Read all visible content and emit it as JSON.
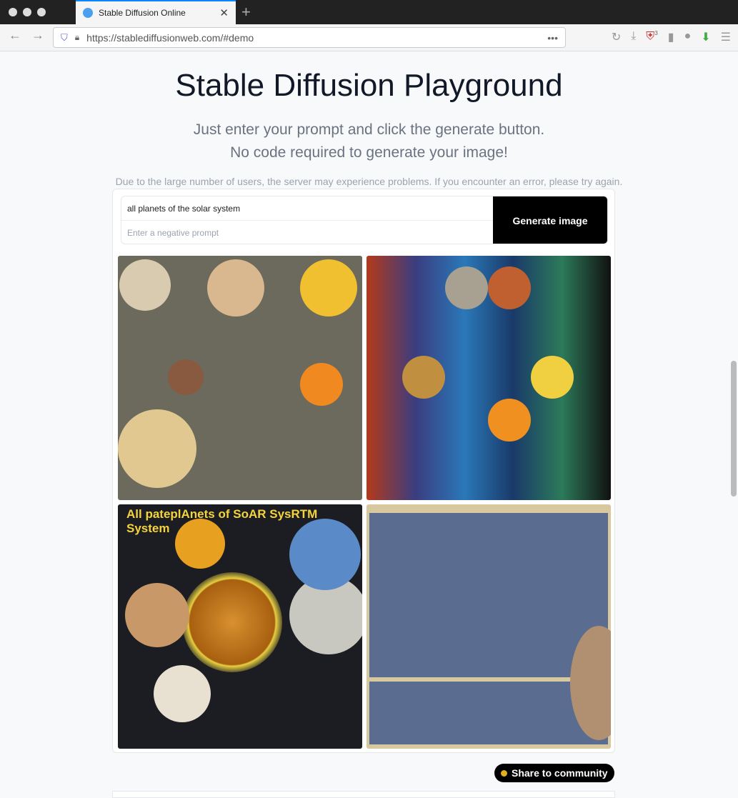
{
  "browser": {
    "tab_title": "Stable Diffusion Online",
    "url": "https://stablediffusionweb.com/#demo",
    "badge": "3"
  },
  "page": {
    "title": "Stable Diffusion Playground",
    "subtitle1": "Just enter your prompt and click the generate button.",
    "subtitle2": "No code required to generate your image!",
    "notice": "Due to the large number of users, the server may experience problems. If you encounter an error, please try again."
  },
  "form": {
    "prompt": "all planets of the solar system",
    "negative_placeholder": "Enter a negative prompt",
    "generate_label": "Generate image"
  },
  "images": [
    {
      "caption": ""
    },
    {
      "caption": ""
    },
    {
      "caption": "All pateplAnets of SoAR SysRTM System"
    },
    {
      "caption": ""
    }
  ],
  "share_label": "Share to community"
}
